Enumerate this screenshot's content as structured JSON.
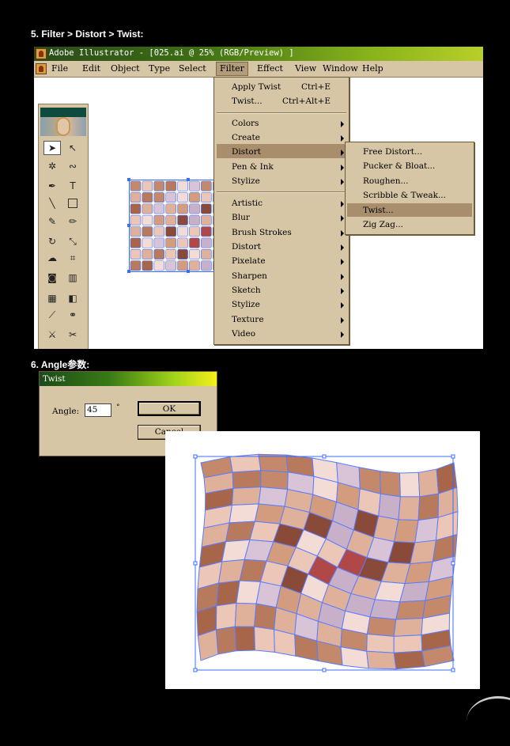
{
  "headings": {
    "step5": "5. Filter > Distort > Twist:",
    "step6": "6. Angle参数:"
  },
  "window": {
    "title": "Adobe Illustrator - [025.ai @ 25% (RGB/Preview) ]"
  },
  "menubar": [
    "File",
    "Edit",
    "Object",
    "Type",
    "Select",
    "Filter",
    "Effect",
    "View",
    "Window",
    "Help"
  ],
  "filter_menu": {
    "top": [
      {
        "label": "Apply Twist",
        "shortcut": "Ctrl+E"
      },
      {
        "label": "Twist...",
        "shortcut": "Ctrl+Alt+E"
      }
    ],
    "group1": [
      "Colors",
      "Create",
      "Distort",
      "Pen & Ink",
      "Stylize"
    ],
    "group2": [
      "Artistic",
      "Blur",
      "Brush Strokes",
      "Distort",
      "Pixelate",
      "Sharpen",
      "Sketch",
      "Stylize",
      "Texture",
      "Video"
    ]
  },
  "distort_submenu": [
    "Free Distort...",
    "Pucker & Bloat...",
    "Roughen...",
    "Scribble & Tweak...",
    "Twist...",
    "Zig Zag..."
  ],
  "dialog": {
    "title": "Twist",
    "angle_label": "Angle:",
    "angle_value": "45",
    "degree_symbol": "°",
    "ok": "OK",
    "cancel": "Cancel"
  },
  "colors": {
    "accent_selection": "#3b6cff",
    "menu_bg": "#d6c6a6",
    "menu_highlight": "#a88e6c"
  }
}
